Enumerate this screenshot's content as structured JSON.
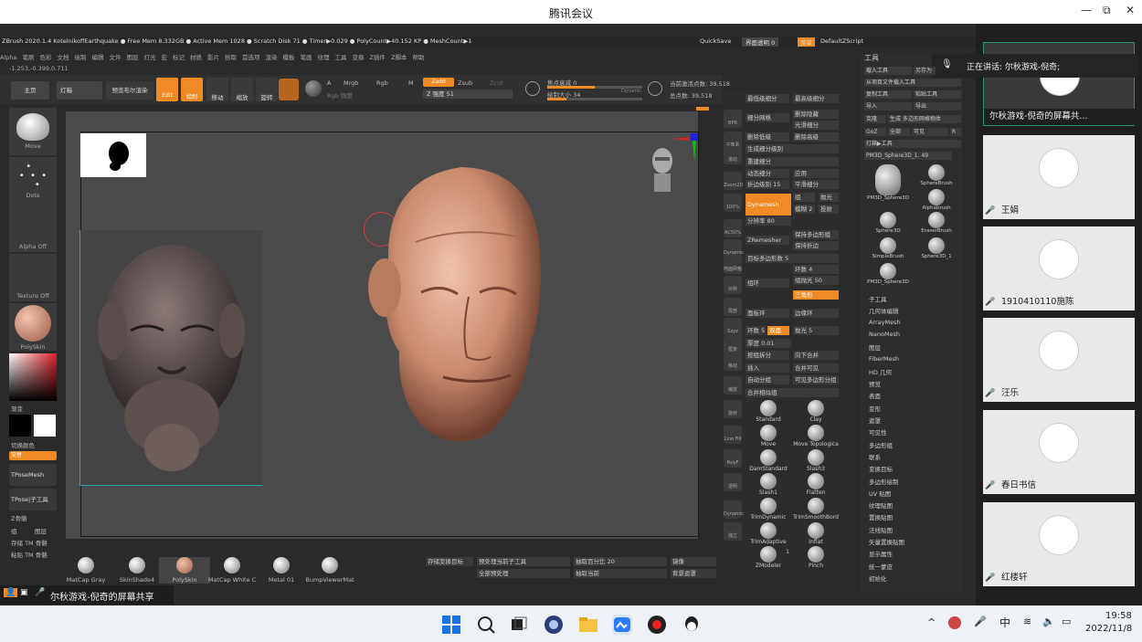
{
  "window": {
    "title": "腾讯会议",
    "minimize": "—",
    "restore": "⧉",
    "close": "✕"
  },
  "zbrush": {
    "status_line": "ZBrush 2020.1.4   KotelnikoffEarthquake  ● Free Mem 8.332GB ● Active Mem 1028 ● Scratch Disk 71 ● Timer▶0.029 ● PolyCount▶40.152 KP ● MeshCount▶1",
    "quicksave": "QuickSave",
    "interface_alpha": "界面透明 0",
    "menu_label": "菜单",
    "default_script": "DefaultZScript",
    "menus": [
      "Alpha",
      "笔刷",
      "色彩",
      "文档",
      "绘制",
      "编辑",
      "文件",
      "图层",
      "灯光",
      "宏",
      "标记",
      "材质",
      "影片",
      "拾取",
      "首选项",
      "渲染",
      "模板",
      "笔画",
      "纹理",
      "工具",
      "变换",
      "Z插件",
      "Z脚本",
      "帮助"
    ],
    "coords": "-1.253,-0.399,0.711",
    "toolbar": {
      "home": "主页",
      "lightbox": "灯箱",
      "preview_render": "预览布尔渲染",
      "edit": "Edit",
      "draw": "绘制",
      "move": "移动",
      "scale": "缩放",
      "rotate": "旋转",
      "a": "A",
      "mrgb": "Mrgb",
      "rgb": "Rgb",
      "m": "M",
      "rgb_intensity": "Rgb 强度",
      "zadd": "Zadd",
      "zsub": "Zsub",
      "zcut": "Zcut",
      "z_intensity": "Z 强度 51",
      "focal_shift": "焦点衰减 0",
      "draw_size": "绘制大小 34",
      "dynamic": "Dynamic",
      "active_points": "当前激活点数: 39,518",
      "total_points": "总点数: 39,518"
    },
    "left_shelf": {
      "move": "Move",
      "dots": "Dots",
      "alpha_off": "Alpha Off",
      "texture_off": "Texture Off",
      "polyskin": "PolySkin",
      "gradient": "渐变",
      "switch_color": "切换颜色",
      "alternate": "交替",
      "tpose_mesh": "TPoseMesh",
      "tpose_sub": "TPose|子工具",
      "z_skeleton": "Z骨骼",
      "group": "组",
      "layer": "图层",
      "save_tm": "存储 TM 骨骼",
      "paste_tm": "粘贴 TM 骨骼"
    },
    "right_icons": [
      "BPR",
      "子像素",
      "滚动",
      "Zoom2D",
      "100%",
      "AC50%",
      "Dynamic透视",
      "地面网格",
      "对称",
      "局部",
      "Sxyz",
      "框架",
      "移动",
      "缩放",
      "旋转",
      "Line Fill",
      "PolyF",
      "透明",
      "Dynamic",
      "独立"
    ],
    "subdiv": {
      "lowest": "最低级细分",
      "highest": "最高级细分",
      "subdivide": "细分网格",
      "delete_hidden": "删除隐藏",
      "smooth_subdiv": "光滑细分",
      "delete_lower": "删除低级",
      "delete_higher": "删除高级",
      "generate": "生成细分级别",
      "rebuild": "重建细分",
      "dynamic_subdiv": "动态细分",
      "apply": "应用",
      "crease_level": "折边级别 15",
      "smooth_sub": "平滑细分",
      "dynamesh": "Dynamesh",
      "group": "组",
      "polish": "抛光",
      "blur": "模糊 2",
      "project": "投射",
      "resolution": "分辨率 80",
      "zremesher": "ZRemesher",
      "keep_groups": "保持多边形组",
      "keep_creases": "保持折边",
      "target_polys": "目标多边形数 5",
      "count": "环数 4",
      "loop": "组抛光 50",
      "ring": "组环",
      "triangle": "三角形",
      "panel_loops": "面板环",
      "edge_loop": "边缘环",
      "loops_5": "环数 5",
      "double": "双面",
      "polish_5": "抛光 5",
      "thickness": "厚度 0.01",
      "group_split": "按组拆分",
      "merge_down": "向下合并",
      "insert": "插入",
      "merge_visible": "合并可见",
      "auto_group": "自动分组",
      "visible_groups": "可见多边形分组",
      "merge_similar": "合并相似组"
    },
    "brushes": [
      "Standard",
      "Clay",
      "Move",
      "Move Topologica",
      "DamStandard",
      "Slash3",
      "Slash1",
      "Flatten",
      "TrimDynamic",
      "TrimSmoothBord",
      "TrimAdaptive",
      "Inflat",
      "ZModeler",
      "Pinch"
    ],
    "zmodeler_count": "1",
    "tool_panel": {
      "title": "工具",
      "load_tool": "载入工具",
      "save_as": "另存为",
      "load_from_project": "从项目文件载入工具",
      "copy_tool": "复制工具",
      "paste_tool": "粘贴工具",
      "import": "导入",
      "export": "导出",
      "clone": "克隆",
      "make_polymesh": "生成 多边形网格物体",
      "goz": "GoZ",
      "all": "全部",
      "visible": "可见",
      "r": "R",
      "lightbox_tools": "灯箱▶工具",
      "current_tool": "PM3D_Sphere3D_1. 49",
      "thumbs": [
        "PM3D_Sphere3D",
        "SphereBrush",
        "Alphabrush",
        "Sphere3D",
        "EraserBrush",
        "SimpleBrush",
        "Sphere3D_1",
        "PM3D_Sphere3D"
      ],
      "sections": [
        "子工具",
        "几何体编辑",
        "ArrayMesh",
        "NanoMesh",
        "图层",
        "FiberMesh",
        "HD 几何",
        "预览",
        "表面",
        "变形",
        "遮罩",
        "可见性",
        "多边形组",
        "联系",
        "变换目标",
        "多边形绘制",
        "UV 贴图",
        "纹理贴图",
        "置换贴图",
        "法线贴图",
        "矢量置换贴图",
        "显示属性",
        "统一蒙皮",
        "初始化"
      ]
    },
    "materials": [
      "MatCap Gray",
      "SkinShade4",
      "PolySkin",
      "MatCap White C",
      "Metal 01",
      "BumpViewerMat"
    ],
    "bottom": {
      "store_morph": "存储变换目标",
      "preview_subtool": "预处理当前子工具",
      "preview_all": "全部预处理",
      "take_percent": "抽取百分比 20",
      "take_current": "抽取当前",
      "mirror": "镜像",
      "bg_mask": "背景遮罩"
    }
  },
  "meeting": {
    "speaking": "正在讲话: 尔秋游戏-倪奇;",
    "self_share": "尔秋游戏-倪奇的屏幕共...",
    "participants": [
      "王娟",
      "1910410110施陈",
      "汪乐",
      "春日书信",
      "红楼轩"
    ],
    "share_bar": "尔秋游戏-倪奇的屏幕共享"
  },
  "taskbar": {
    "ime": "中",
    "time": "19:58",
    "date": "2022/11/8"
  },
  "colors": {
    "accent": "#f08a24",
    "skin": "#c98b6e"
  }
}
